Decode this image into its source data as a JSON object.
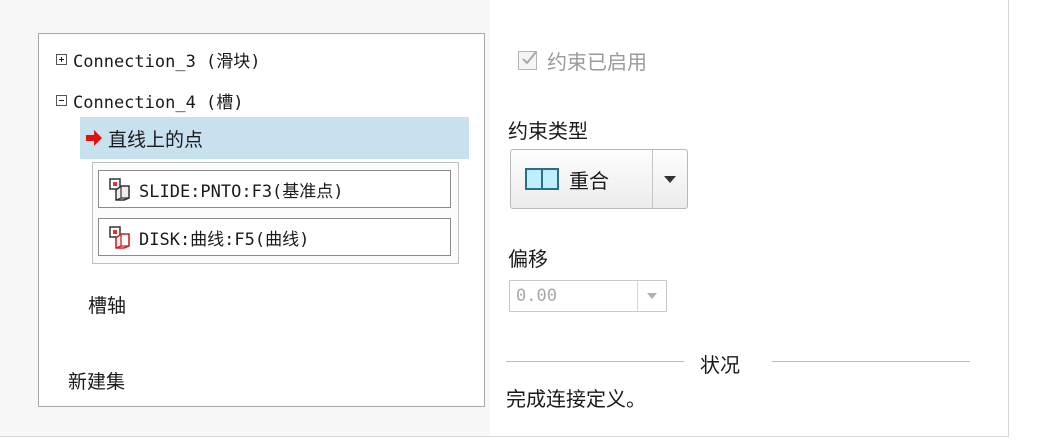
{
  "tree": {
    "connection3_label": "Connection_3 (滑块)",
    "connection4_label": "Connection_4 (槽)",
    "constraint_label": "直线上的点",
    "refs": [
      "SLIDE:PNTO:F3(基准点)",
      "DISK:曲线:F5(曲线)"
    ],
    "slot_axis_label": "槽轴",
    "new_set_label": "新建集"
  },
  "constraint": {
    "enabled_label": "约束已启用",
    "enabled_checked": true,
    "type_label": "约束类型",
    "type_value": "重合",
    "offset_label": "偏移",
    "offset_value": "0.00",
    "status_label": "状况",
    "status_text": "完成连接定义。"
  },
  "colors": {
    "selection": "#c8e1ef",
    "arrow": "#e01010",
    "coincident_fill": "#bfefff"
  }
}
